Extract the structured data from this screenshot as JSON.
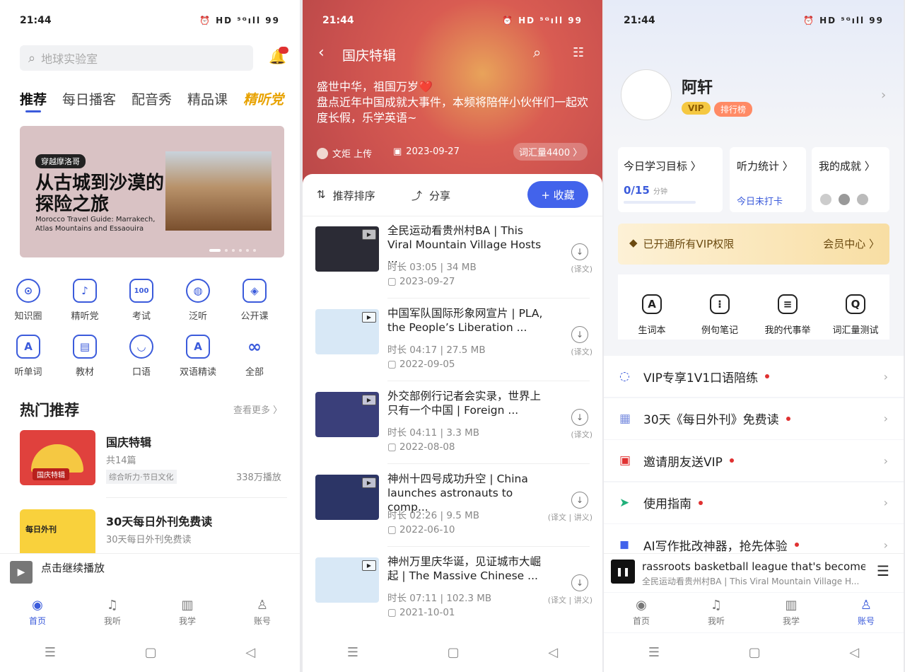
{
  "status": {
    "time": "21:44",
    "icons": "⏰ HD ⁵ᴳıll 99"
  },
  "home": {
    "search_placeholder": "地球实验室",
    "tabs": [
      "推荐",
      "每日播客",
      "配音秀",
      "精品课",
      "精听党"
    ],
    "banner": {
      "tag": "穿越摩洛哥",
      "title1": "从古城到沙漠的",
      "title2": "探险之旅",
      "subtitle1": "Morocco Travel Guide: Marrakech,",
      "subtitle2": "Atlas Mountains and Essaouira"
    },
    "grid": [
      {
        "label": "知识圈",
        "icon": "⊙"
      },
      {
        "label": "精听党",
        "icon": "♪"
      },
      {
        "label": "考试",
        "icon": "100"
      },
      {
        "label": "泛听",
        "icon": "◍"
      },
      {
        "label": "公开课",
        "icon": "◈"
      },
      {
        "label": "听单词",
        "icon": "A"
      },
      {
        "label": "教材",
        "icon": "▤"
      },
      {
        "label": "口语",
        "icon": "◡"
      },
      {
        "label": "双语精读",
        "icon": "A"
      },
      {
        "label": "全部",
        "icon": "∞"
      }
    ],
    "hot_title": "热门推荐",
    "hot_more": "查看更多 〉",
    "hot_items": [
      {
        "title": "国庆特辑",
        "sub": "共14篇",
        "tag": "综合听力·节日文化",
        "plays": "338万播放",
        "thumb_text": "国庆特辑"
      },
      {
        "title": "30天每日外刊免费读",
        "sub": "30天每日外刊免费读",
        "tag": "",
        "plays": "",
        "thumb_text": "每日外刊"
      }
    ],
    "continue_label": "点击继续播放",
    "nav": [
      "首页",
      "我听",
      "我学",
      "账号"
    ]
  },
  "album": {
    "title": "国庆特辑",
    "desc1": "盛世中华，祖国万岁❤️",
    "desc2": "盘点近年中国成就大事件，本频将陪伴小伙伴们一起欢度长假，乐学英语~",
    "author": "文炬 上传",
    "date": "2023-09-27",
    "vocab": "词汇量4400 〉",
    "sort_label": "推荐排序",
    "share_label": "分享",
    "collect_label": "+ 收藏",
    "items": [
      {
        "title": "全民运动看贵州村BA | This Viral Mountain Village Hosts ...",
        "meta": "时长 03:05 | 34 MB",
        "date": "2023-09-27",
        "dl": "(译文)",
        "thumb": "#2b2b35"
      },
      {
        "title": "中国军队国际形象网宣片 | PLA, the People’s Liberation ...",
        "meta": "时长 04:17 | 27.5 MB",
        "date": "2022-09-05",
        "dl": "(译文)",
        "thumb": "#d8e8f6"
      },
      {
        "title": "外交部例行记者会实录，世界上只有一个中国 | Foreign ...",
        "meta": "时长 04:11 | 3.3 MB",
        "date": "2022-08-08",
        "dl": "(译文)",
        "thumb": "#3a3f7a"
      },
      {
        "title": "神州十四号成功升空 | China launches astronauts to comp...",
        "meta": "时长 02:26 | 9.5 MB",
        "date": "2022-06-10",
        "dl": "(译文 | 讲义)",
        "thumb": "#2c3566"
      },
      {
        "title": "神州万里庆华诞，见证城市大崛起 | The Massive Chinese ...",
        "meta": "时长 07:11 | 102.3 MB",
        "date": "2021-10-01",
        "dl": "(译文 | 讲义)",
        "thumb": "#d8e8f6"
      }
    ]
  },
  "account": {
    "name": "阿轩",
    "vip_badge": "VIP",
    "rank_badge": "排行榜",
    "cards": [
      {
        "title": "今日学习目标 〉",
        "value": "0/15",
        "unit": "分钟"
      },
      {
        "title": "听力统计 〉",
        "value": "今日未打卡"
      },
      {
        "title": "我的成就 〉",
        "value": ""
      }
    ],
    "vip_text": "已开通所有VIP权限",
    "vip_center": "会员中心 〉",
    "tools": [
      {
        "label": "生词本",
        "icon": "A"
      },
      {
        "label": "例句笔记",
        "icon": "⁝"
      },
      {
        "label": "我的代事举",
        "icon": "≡"
      },
      {
        "label": "词汇量测试",
        "icon": "Q"
      }
    ],
    "menu": [
      {
        "label": "VIP专享1V1口语陪练",
        "icon": "◌",
        "color": "#3b5bdb"
      },
      {
        "label": "30天《每日外刊》免费读",
        "icon": "▦",
        "color": "#7b8fe0"
      },
      {
        "label": "邀请朋友送VIP",
        "icon": "▣",
        "color": "#e03131"
      },
      {
        "label": "使用指南",
        "icon": "➤",
        "color": "#20b07a"
      },
      {
        "label": "AI写作批改神器，抢先体验",
        "icon": "◼",
        "color": "#4263eb"
      }
    ],
    "mini_player_title": "rassroots basketball league that's become",
    "mini_player_sub": "全民运动看贵州村BA | This Viral Mountain Village H..."
  }
}
